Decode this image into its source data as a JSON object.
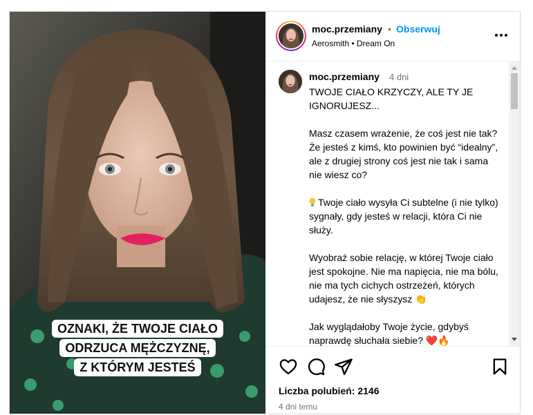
{
  "post": {
    "caption_overlay": [
      "OZNAKI, ŻE TWOJE CIAŁO",
      "ODRZUCA MĘŻCZYZNĘ,",
      "Z KTÓRYM JESTEŚ"
    ]
  },
  "header": {
    "username": "moc.przemiany",
    "separator": "•",
    "follow_label": "Obserwuj",
    "audio": "Aerosmith • Dream On",
    "more_icon": "more-horizontal-icon"
  },
  "comment": {
    "username": "moc.przemiany",
    "time": "4 dni",
    "paragraphs": [
      "TWOJE CIAŁO KRZYCZY, ALE TY JE IGNORUJESZ...",
      "Masz czasem wrażenie, że coś jest nie tak? Że jesteś z kimś, kto powinien być “idealny”, ale z drugiej strony coś jest nie tak i sama nie wiesz co?",
      "Twoje ciało wysyła Ci subtelne (i nie tylko) sygnały, gdy jesteś w relacji, która Ci nie służy.",
      "Wyobraź sobie relację, w której Twoje ciało jest spokojne. Nie ma napięcia, nie ma bólu, nie ma tych cichych ostrzeżeń, których udajesz, że nie słyszysz 👏",
      "Jak wyglądałoby Twoje życie, gdybyś naprawdę słuchała siebie? ❤️🔥"
    ]
  },
  "actions": {
    "icons": [
      "heart-icon",
      "comment-icon",
      "share-icon",
      "bookmark-icon"
    ],
    "likes_label": "Liczba polubień: 2146",
    "date": "4 dni temu"
  },
  "colors": {
    "follow": "#0095f6",
    "muted": "#737373",
    "border": "#dbdbdb"
  }
}
